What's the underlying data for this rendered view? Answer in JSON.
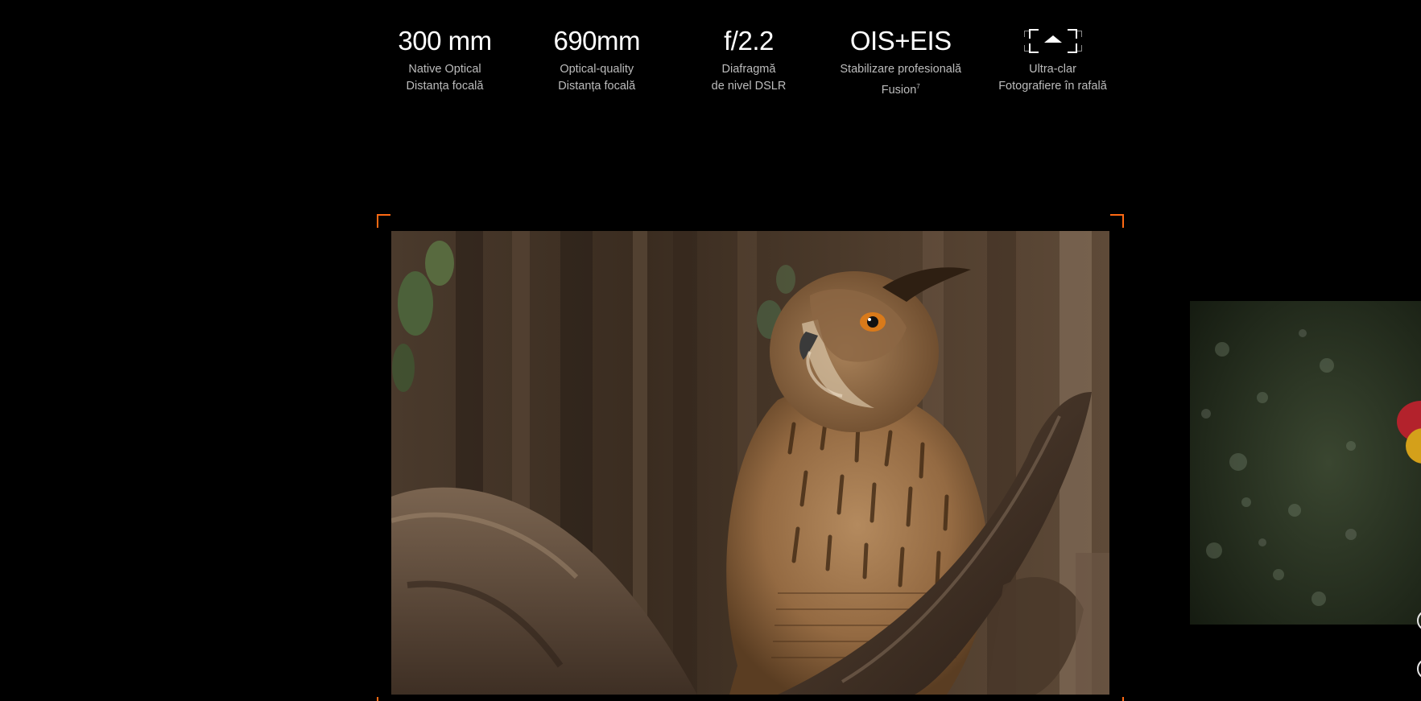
{
  "specs": [
    {
      "value": "300 mm",
      "line1": "Native Optical",
      "line2": "Distanța focală",
      "footnote": ""
    },
    {
      "value": "690mm",
      "line1": "Optical-quality",
      "line2": "Distanța focală",
      "footnote": ""
    },
    {
      "value": "f/2.2",
      "line1": "Diafragmă",
      "line2": "de nivel DSLR",
      "footnote": ""
    },
    {
      "value": "OIS+EIS",
      "line1": "Stabilizare profesională",
      "line2": "Fusion",
      "footnote": "7"
    },
    {
      "icon": "burst-shot-icon",
      "line1": "Ultra-clar",
      "line2": "Fotografiere în rafală",
      "footnote": ""
    }
  ],
  "colors": {
    "accent": "#ff6a13",
    "background": "#000000",
    "subtext": "#bcbcbc"
  },
  "gallery": {
    "main_photo": "owl-photo",
    "next_photo": "bird-photo"
  }
}
